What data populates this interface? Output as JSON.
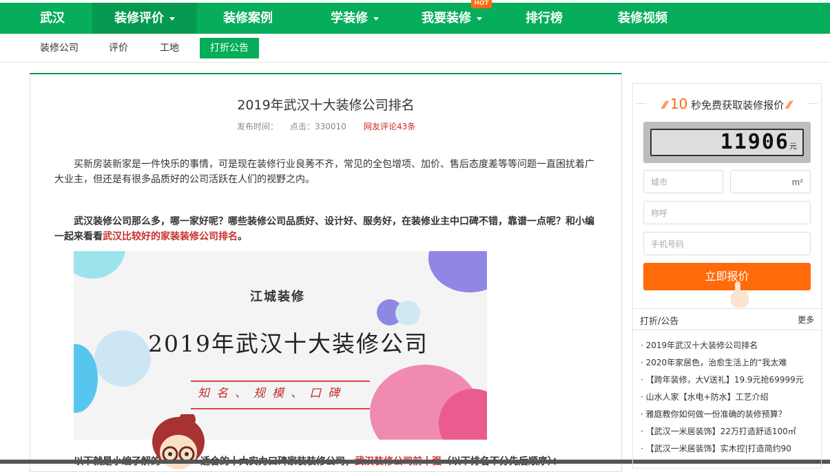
{
  "topnav": {
    "items": [
      {
        "label": "武汉"
      },
      {
        "label": "装修评价"
      },
      {
        "label": "装修案例"
      },
      {
        "label": "学装修"
      },
      {
        "label": "我要装修"
      },
      {
        "label": "排行榜"
      },
      {
        "label": "装修视频"
      }
    ],
    "hot_badge": "HOT"
  },
  "subnav": {
    "items": [
      {
        "label": "装修公司"
      },
      {
        "label": "评价"
      },
      {
        "label": "工地"
      },
      {
        "label": "打折公告"
      }
    ]
  },
  "article": {
    "title": "2019年武汉十大装修公司排名",
    "publish_label": "发布时间：",
    "clicks": "点击：330010",
    "comments": "网友评论43条",
    "para1": "买新房装新家是一件快乐的事情，可是现在装修行业良莠不齐，常见的全包增项、加价、售后态度差等等问题一直困扰着广大业主，但还是有很多品质好的公司活跃在人们的视野之内。",
    "para2_text": "武汉装修公司那么多，哪一家好呢？哪些装修公司品质好、设计好、服务好，在装修业主中口碑不错，靠谱一点呢？和小编一起来看看",
    "para2_link": "武汉比较好的家装装修公司排名",
    "para2_end": "。",
    "banner_brand": "江城装修",
    "banner_title": "2019年武汉十大装修公司",
    "banner_sub": "知名、规模、口碑",
    "bottom_text_a": "以下就是小编了解的",
    "bottom_text_b": "适合的十大实力口碑家装装修公司，",
    "bottom_link": "武汉装修公司前十强",
    "bottom_end": "（以下排名不分先后顺序）："
  },
  "sidebar": {
    "quote_seconds": "10",
    "quote_title": "秒免费获取装修报价",
    "price_value": "11906",
    "price_unit": "元",
    "city_placeholder": "城市",
    "area_unit": "m²",
    "name_placeholder": "称呼",
    "phone_placeholder": "手机号码",
    "quote_button": "立即报价",
    "ann_title": "打折/公告",
    "ann_more": "更多",
    "ann_items": [
      "· 2019年武汉十大装修公司排名",
      "· 2020年家居色，治愈生活上的“我太难",
      "· 【跨年装修，大V送礼】19.9元抢69999元",
      "· 山水人家【水电+防水】工艺介绍",
      "· 雅庭教你如何做一份准确的装修预算？",
      "· 【武汉一米居装饰】22万打造舒适100㎡",
      "· 【武汉一米居装饰】实木控|打造简约90"
    ]
  },
  "colors": {
    "brand_green": "#06ad5a",
    "accent_orange": "#ff6a0a",
    "link_red": "#c9302c"
  }
}
